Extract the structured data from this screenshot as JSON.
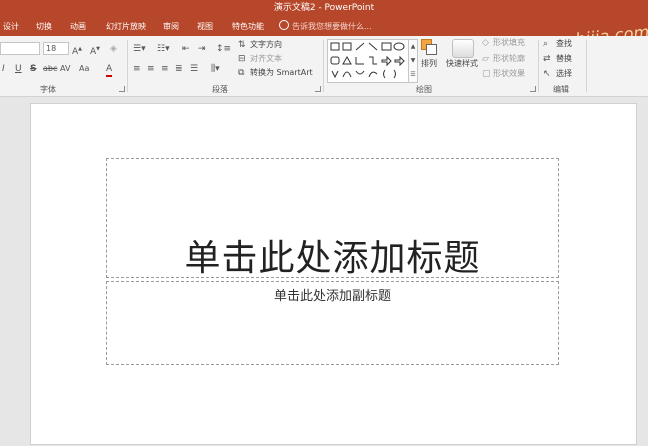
{
  "window": {
    "title": "演示文稿2 - PowerPoint"
  },
  "tabs": [
    {
      "label": "设计"
    },
    {
      "label": "切换"
    },
    {
      "label": "动画"
    },
    {
      "label": "幻灯片放映"
    },
    {
      "label": "审阅"
    },
    {
      "label": "视图"
    },
    {
      "label": "特色功能"
    }
  ],
  "tell_me": "告诉我您想要做什么...",
  "watermark": "jiaochengzhijia.com",
  "ribbon": {
    "font_group": {
      "label": "字体",
      "font_size": "18",
      "buttons": [
        "I",
        "U",
        "S",
        "abc",
        "AV",
        "Aa",
        "A"
      ]
    },
    "paragraph_group": {
      "label": "段落",
      "text_direction": "文字方向",
      "align_text": "对齐文本",
      "convert_smartart": "转换为 SmartArt"
    },
    "drawing_group": {
      "label": "绘图",
      "arrange": "排列",
      "quick_styles": "快速样式",
      "shape_fill": "形状填充",
      "shape_outline": "形状轮廓",
      "shape_effects": "形状效果"
    },
    "editing_group": {
      "label": "编辑",
      "find": "查找",
      "replace": "替换",
      "select": "选择"
    }
  },
  "slide": {
    "title_placeholder": "单击此处添加标题",
    "subtitle_placeholder": "单击此处添加副标题"
  },
  "colors": {
    "accent": "#b7472a",
    "ribbon_bg": "#f3f3f3",
    "canvas_bg": "#e6e6e6"
  }
}
